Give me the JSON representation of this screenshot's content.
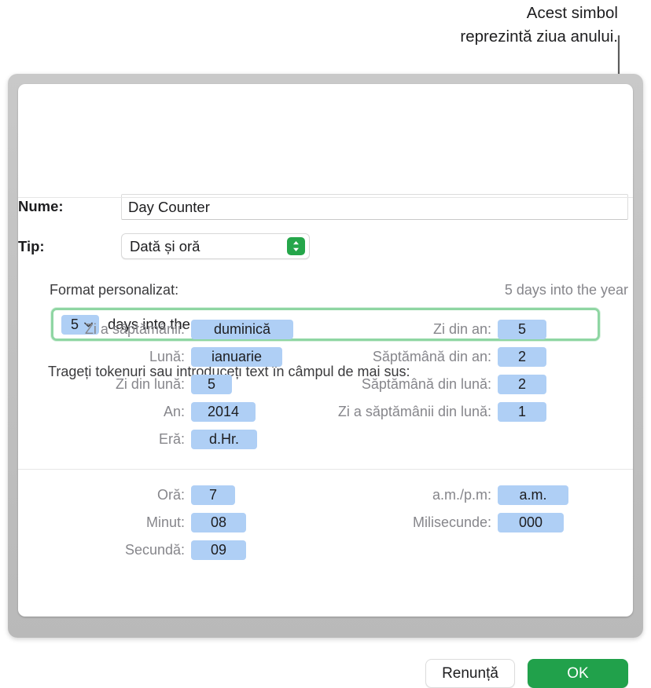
{
  "callout": {
    "text": "Acest simbol\nreprezintă ziua anului."
  },
  "dialog": {
    "name_label": "Nume:",
    "name_value": "Day Counter",
    "type_label": "Tip:",
    "type_value": "Dată și oră",
    "type_stepper_icon": "up-down-chevron-icon",
    "format_label": "Format personalizat:",
    "format_preview": "5 days into the year",
    "format_field": {
      "token_label": "5",
      "token_chevron_icon": "chevron-down-icon",
      "trailing_text": "days into the year"
    },
    "drag_hint": "Trageți tokenuri sau introduceți text în câmpul de mai sus:",
    "date_tokens_left": [
      {
        "label": "Zi a săptămânii:",
        "value": "duminică",
        "width": 130
      },
      {
        "label": "Lună:",
        "value": "ianuarie",
        "width": 116
      },
      {
        "label": "Zi din lună:",
        "value": "5",
        "width": 52
      },
      {
        "label": "An:",
        "value": "2014",
        "width": 82
      },
      {
        "label": "Eră:",
        "value": "d.Hr.",
        "width": 84
      }
    ],
    "date_tokens_right": [
      {
        "label": "Zi din an:",
        "value": "5",
        "width": 62
      },
      {
        "label": "Săptămână din an:",
        "value": "2",
        "width": 62
      },
      {
        "label": "Săptămână din lună:",
        "value": "2",
        "width": 62
      },
      {
        "label": "Zi a săptămânii din lună:",
        "value": "1",
        "width": 62
      }
    ],
    "time_tokens_left": [
      {
        "label": "Oră:",
        "value": "7",
        "width": 56
      },
      {
        "label": "Minut:",
        "value": "08",
        "width": 70
      },
      {
        "label": "Secundă:",
        "value": "09",
        "width": 70
      }
    ],
    "time_tokens_right": [
      {
        "label": "a.m./p.m:",
        "value": "a.m.",
        "width": 90
      },
      {
        "label": "Milisecunde:",
        "value": "000",
        "width": 84
      }
    ],
    "cancel_label": "Renunță",
    "ok_label": "OK"
  },
  "colors": {
    "token_bg": "#afcff5",
    "accent_green": "#21a14b",
    "focus_ring": "#8fd6a3"
  }
}
